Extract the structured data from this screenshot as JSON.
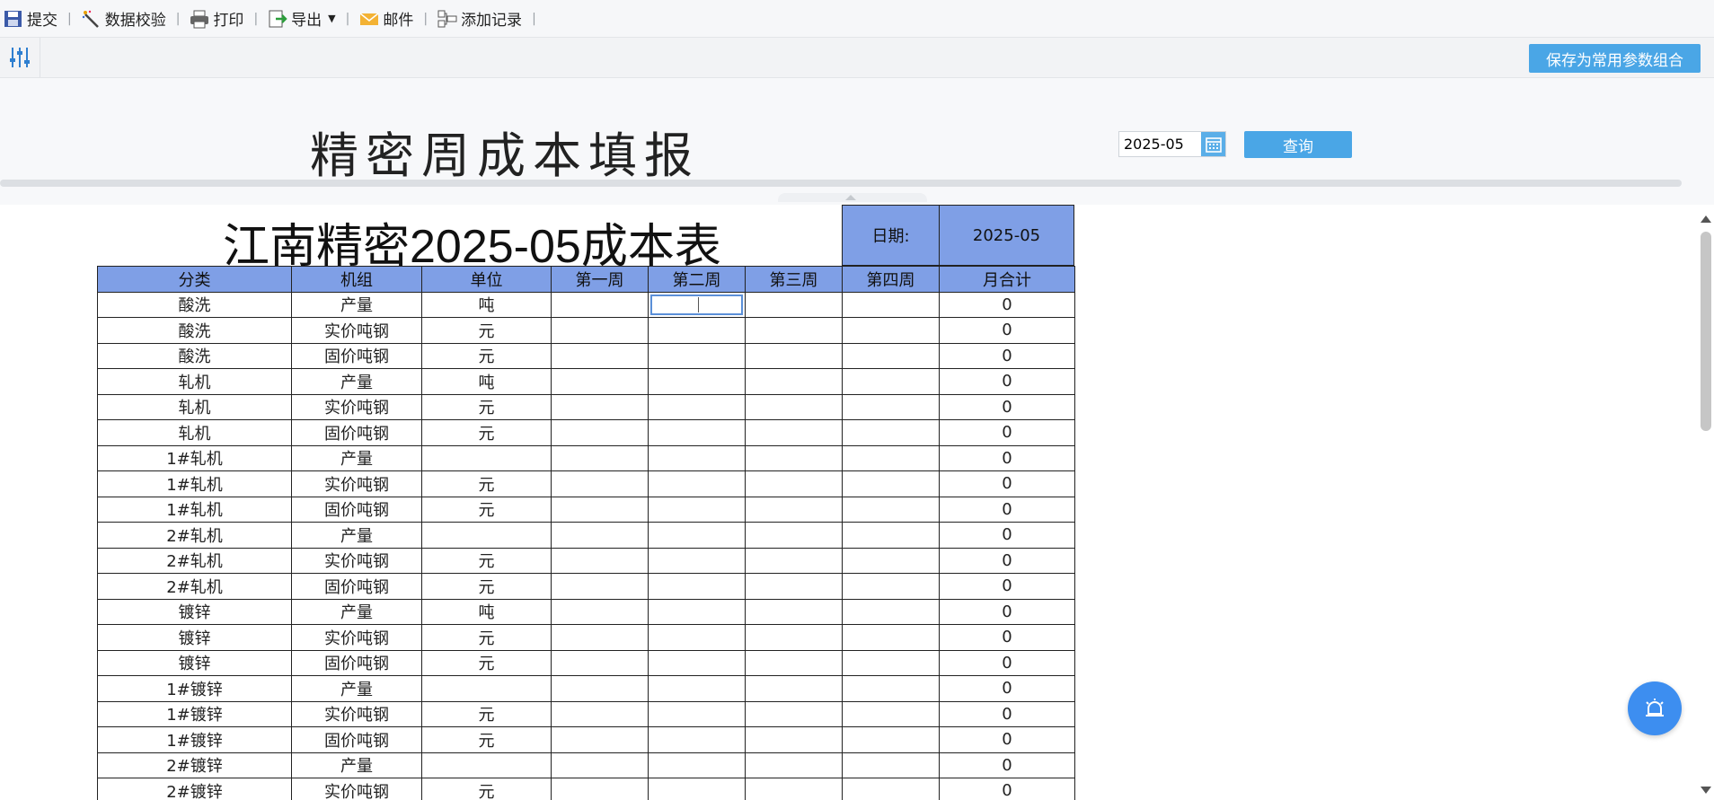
{
  "toolbar": {
    "items": [
      {
        "label": "提交",
        "icon": "save-disk-icon"
      },
      {
        "label": "数据校验",
        "icon": "magic-wand-icon"
      },
      {
        "label": "打印",
        "icon": "printer-icon"
      },
      {
        "label": "导出",
        "icon": "export-icon"
      },
      {
        "label": "邮件",
        "icon": "mail-icon"
      },
      {
        "label": "添加记录",
        "icon": "add-record-icon"
      }
    ],
    "separator": "|"
  },
  "parambar": {
    "save_combo_label": "保存为常用参数组合"
  },
  "query": {
    "page_title": "精密周成本填报",
    "date_value": "2025-05",
    "query_label": "查询"
  },
  "report": {
    "title": "江南精密2025-05成本表",
    "date_label": "日期:",
    "date_value": "2025-05",
    "columns": [
      "分类",
      "机组",
      "单位",
      "第一周",
      "第二周",
      "第三周",
      "第四周",
      "月合计"
    ],
    "rows": [
      [
        "酸洗",
        "产量",
        "吨",
        "",
        "",
        "",
        "",
        "0"
      ],
      [
        "酸洗",
        "实价吨钢",
        "元",
        "",
        "",
        "",
        "",
        "0"
      ],
      [
        "酸洗",
        "固价吨钢",
        "元",
        "",
        "",
        "",
        "",
        "0"
      ],
      [
        "轧机",
        "产量",
        "吨",
        "",
        "",
        "",
        "",
        "0"
      ],
      [
        "轧机",
        "实价吨钢",
        "元",
        "",
        "",
        "",
        "",
        "0"
      ],
      [
        "轧机",
        "固价吨钢",
        "元",
        "",
        "",
        "",
        "",
        "0"
      ],
      [
        "1#轧机",
        "产量",
        "",
        "",
        "",
        "",
        "",
        "0"
      ],
      [
        "1#轧机",
        "实价吨钢",
        "元",
        "",
        "",
        "",
        "",
        "0"
      ],
      [
        "1#轧机",
        "固价吨钢",
        "元",
        "",
        "",
        "",
        "",
        "0"
      ],
      [
        "2#轧机",
        "产量",
        "",
        "",
        "",
        "",
        "",
        "0"
      ],
      [
        "2#轧机",
        "实价吨钢",
        "元",
        "",
        "",
        "",
        "",
        "0"
      ],
      [
        "2#轧机",
        "固价吨钢",
        "元",
        "",
        "",
        "",
        "",
        "0"
      ],
      [
        "镀锌",
        "产量",
        "吨",
        "",
        "",
        "",
        "",
        "0"
      ],
      [
        "镀锌",
        "实价吨钢",
        "元",
        "",
        "",
        "",
        "",
        "0"
      ],
      [
        "镀锌",
        "固价吨钢",
        "元",
        "",
        "",
        "",
        "",
        "0"
      ],
      [
        "1#镀锌",
        "产量",
        "",
        "",
        "",
        "",
        "",
        "0"
      ],
      [
        "1#镀锌",
        "实价吨钢",
        "元",
        "",
        "",
        "",
        "",
        "0"
      ],
      [
        "1#镀锌",
        "固价吨钢",
        "元",
        "",
        "",
        "",
        "",
        "0"
      ],
      [
        "2#镀锌",
        "产量",
        "",
        "",
        "",
        "",
        "",
        "0"
      ],
      [
        "2#镀锌",
        "实价吨钢",
        "元",
        "",
        "",
        "",
        "",
        "0"
      ]
    ],
    "selected_cell": {
      "row": 0,
      "col": 4
    }
  },
  "colors": {
    "header_bg": "#7f9fe6",
    "button_blue": "#4aa6e6",
    "fab_blue": "#3d8ef0"
  },
  "fab": {
    "icon": "alarm-bell-icon"
  }
}
